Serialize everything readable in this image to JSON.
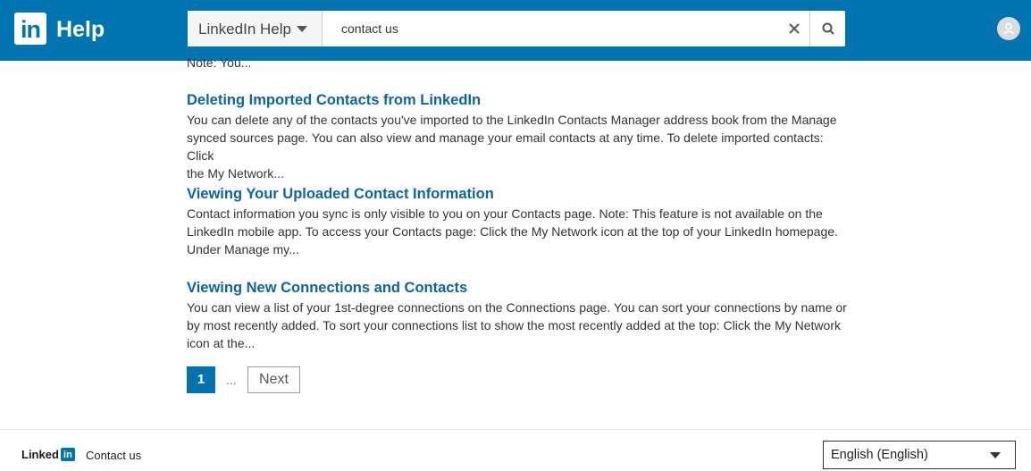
{
  "header": {
    "logo_text": "in",
    "title": "Help",
    "search": {
      "scope_label": "LinkedIn Help",
      "query": "contact us",
      "placeholder": ""
    },
    "colors": {
      "brand": "#0073b1"
    }
  },
  "results": {
    "previous_snippet_tail": "Note: You...",
    "items": [
      {
        "title": "Deleting Imported Contacts from LinkedIn",
        "snippet_lines": [
          "You can delete any of the contacts you've imported to the LinkedIn Contacts Manager address book from the Manage",
          "synced sources page. You can also view and manage your email contacts at any time. To delete imported contacts: Click",
          "the My Network..."
        ]
      },
      {
        "title": "Viewing Your Uploaded Contact Information",
        "snippet_lines": [
          "Contact information you sync is only visible to you on your Contacts page. Note: This feature is not available on the",
          "LinkedIn mobile app. To access your Contacts page: Click the My Network icon at the top of your LinkedIn homepage.",
          "Under Manage my..."
        ]
      },
      {
        "title": "Viewing New Connections and Contacts",
        "snippet_lines": [
          "You can view a list of your 1st-degree connections on the Connections page. You can sort your connections by name or",
          "by most recently added. To sort your connections list to show the most recently added at the top: Click the My Network",
          "icon at the..."
        ]
      }
    ]
  },
  "pagination": {
    "current_page": "1",
    "ellipsis": "...",
    "next_label": "Next"
  },
  "footer": {
    "logo_word": "Linked",
    "logo_in": "in",
    "contact_label": "Contact us",
    "language": "English (English)"
  }
}
